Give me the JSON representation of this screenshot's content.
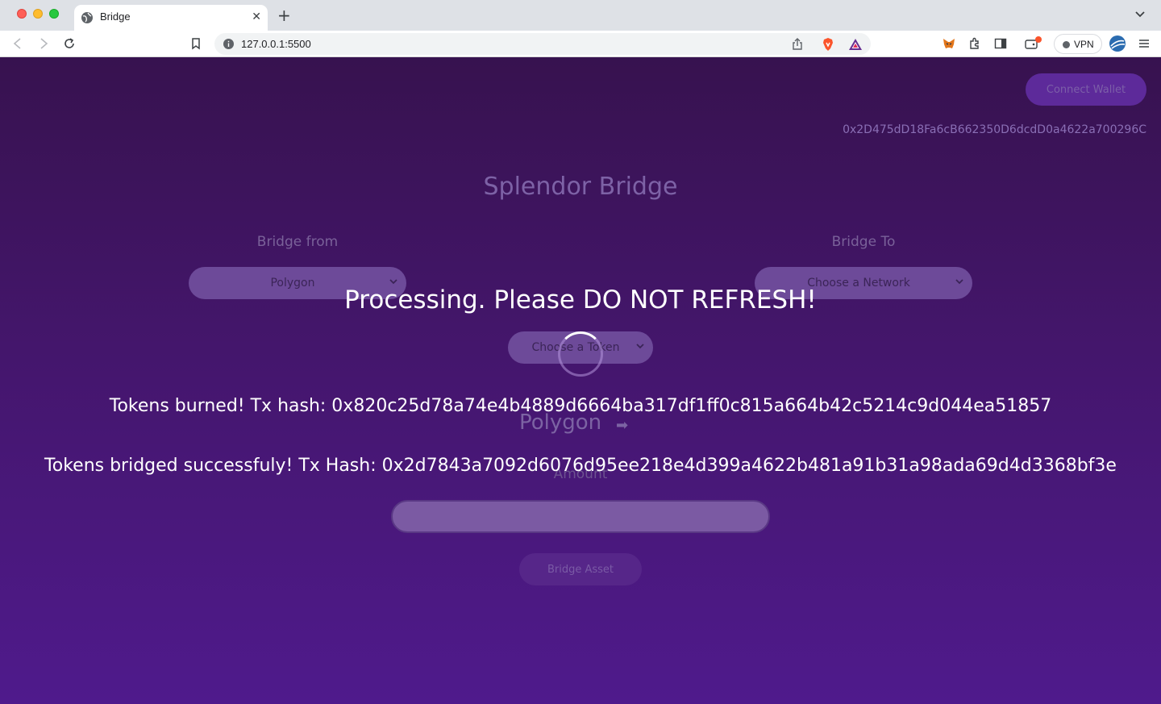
{
  "browser": {
    "tab_title": "Bridge",
    "tab_close": "✕",
    "new_tab": "+",
    "url": "127.0.0.1:5500",
    "vpn_label": "VPN"
  },
  "header": {
    "connect_label": "Connect Wallet",
    "wallet_address": "0x2D475dD18Fa6cB662350D6dcdD0a4622a700296C"
  },
  "main": {
    "title": "Splendor Bridge",
    "bridge_from_label": "Bridge from",
    "bridge_from_value": "Polygon",
    "bridge_to_label": "Bridge To",
    "bridge_to_value": "Choose a Network",
    "token_value": "Choose a Token",
    "network_display": "Polygon",
    "network_arrow": "➡",
    "amount_label": "Amount",
    "bridge_button": "Bridge Asset"
  },
  "overlay": {
    "processing": "Processing. Please DO NOT REFRESH!",
    "burned": "Tokens burned! Tx hash: 0x820c25d78a74e4b4889d6664ba317df1ff0c815a664b42c5214c9d044ea51857",
    "bridged": "Tokens bridged successfuly! Tx Hash: 0x2d7843a7092d6076d95ee218e4d399a4622b481a91b31a98ada69d4d3368bf3e"
  },
  "colors": {
    "page_top": "#37124f",
    "page_bottom": "#4f1a8c",
    "overlay_text": "#ffffff"
  }
}
